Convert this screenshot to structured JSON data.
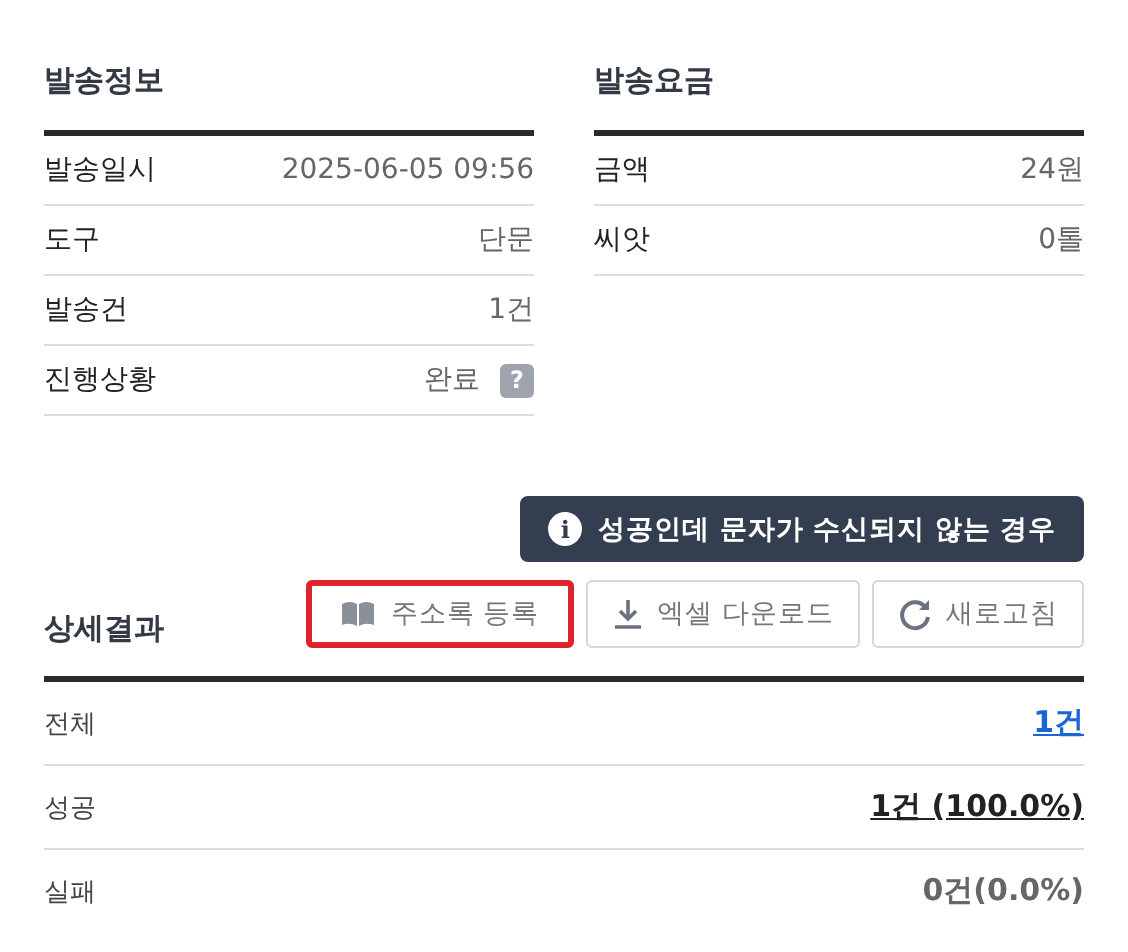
{
  "send_info": {
    "title": "발송정보",
    "rows": [
      {
        "label": "발송일시",
        "value": "2025-06-05 09:56"
      },
      {
        "label": "도구",
        "value": "단문"
      },
      {
        "label": "발송건",
        "value": "1건"
      },
      {
        "label": "진행상황",
        "value": "완료",
        "help": "?"
      }
    ]
  },
  "send_fee": {
    "title": "발송요금",
    "rows": [
      {
        "label": "금액",
        "value": "24원"
      },
      {
        "label": "씨앗",
        "value": "0톨"
      }
    ]
  },
  "notice_button": {
    "icon": "i",
    "label": "성공인데 문자가 수신되지 않는 경우"
  },
  "detail": {
    "title": "상세결과",
    "buttons": [
      {
        "kind": "book",
        "label": "주소록 등록",
        "highlighted": true
      },
      {
        "kind": "download",
        "label": "엑셀 다운로드",
        "highlighted": false
      },
      {
        "kind": "refresh",
        "label": "새로고침",
        "highlighted": false
      }
    ],
    "rows": [
      {
        "label": "전체",
        "value": "1건",
        "kind": "link"
      },
      {
        "label": "성공",
        "value": "1건 (100.0%)",
        "kind": "underlined"
      },
      {
        "label": "실패",
        "value": "0건(0.0%)",
        "kind": "plain"
      }
    ]
  }
}
